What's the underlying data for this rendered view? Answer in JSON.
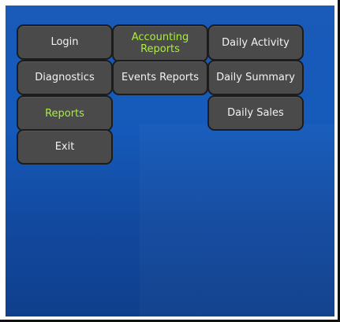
{
  "menu": {
    "column1": {
      "login": "Login",
      "diagnostics": "Diagnostics",
      "reports": "Reports",
      "exit": "Exit"
    },
    "column2": {
      "accounting_reports": "Accounting\nReports",
      "events_reports": "Events Reports"
    },
    "column3": {
      "daily_activity": "Daily Activity",
      "daily_summary": "Daily Summary",
      "daily_sales": "Daily Sales"
    }
  },
  "colors": {
    "background": "#155aba",
    "button": "#4a4a4a",
    "button_border": "#1c1c1c",
    "text": "#f2f2f2",
    "active_text": "#a8f03a"
  },
  "active_items": [
    "Reports",
    "Accounting Reports"
  ]
}
